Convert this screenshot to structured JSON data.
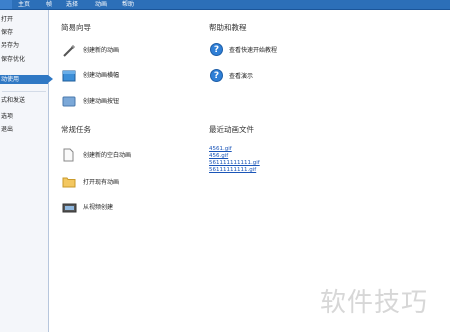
{
  "menubar": {
    "tabs": [
      "主页",
      "帧",
      "选择",
      "动画",
      "帮助"
    ]
  },
  "sidebar": {
    "items": [
      "打开",
      "保存",
      "另存为",
      "保存优化",
      "动使用",
      "式和发送",
      "选项",
      "退出"
    ],
    "active": "动使用"
  },
  "quick_start": {
    "title": "简易向导",
    "items": [
      "创建新的动画",
      "创建动画横幅",
      "创建动画按钮"
    ]
  },
  "tasks": {
    "title": "常规任务",
    "items": [
      "创建新的空白动画",
      "打开现有动画",
      "从视频创建"
    ]
  },
  "help": {
    "title": "帮助和教程",
    "items": [
      "查看快速开始教程",
      "查看演示"
    ]
  },
  "recent": {
    "title": "最近动画文件",
    "files": [
      "4561.gif",
      "456.gif",
      "561111111111.gif",
      "56111111111.gif"
    ]
  },
  "watermark": "软件技巧",
  "colors": {
    "menubar": "#2c6fb8",
    "active": "#2f78c4",
    "link": "#1a55b8"
  }
}
